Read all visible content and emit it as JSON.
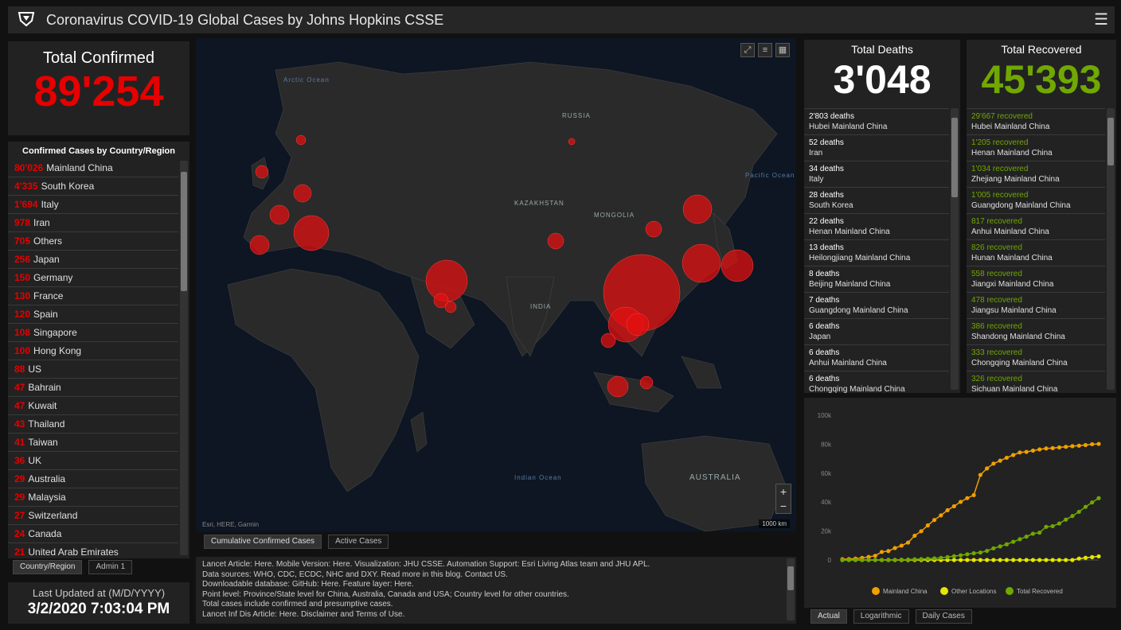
{
  "header": {
    "title": "Coronavirus COVID-19 Global Cases by Johns Hopkins CSSE",
    "logo_icon": "csse-shield-logo",
    "menu_icon": "hamburger-menu-icon"
  },
  "confirmed": {
    "label": "Total Confirmed",
    "value": "89'254",
    "color": "#e60000"
  },
  "country_list": {
    "heading": "Confirmed Cases by Country/Region",
    "rows": [
      {
        "count": "80'026",
        "name": "Mainland China"
      },
      {
        "count": "4'335",
        "name": "South Korea"
      },
      {
        "count": "1'694",
        "name": "Italy"
      },
      {
        "count": "978",
        "name": "Iran"
      },
      {
        "count": "705",
        "name": "Others"
      },
      {
        "count": "256",
        "name": "Japan"
      },
      {
        "count": "150",
        "name": "Germany"
      },
      {
        "count": "130",
        "name": "France"
      },
      {
        "count": "120",
        "name": "Spain"
      },
      {
        "count": "108",
        "name": "Singapore"
      },
      {
        "count": "100",
        "name": "Hong Kong"
      },
      {
        "count": "88",
        "name": "US"
      },
      {
        "count": "47",
        "name": "Bahrain"
      },
      {
        "count": "47",
        "name": "Kuwait"
      },
      {
        "count": "43",
        "name": "Thailand"
      },
      {
        "count": "41",
        "name": "Taiwan"
      },
      {
        "count": "36",
        "name": "UK"
      },
      {
        "count": "29",
        "name": "Australia"
      },
      {
        "count": "29",
        "name": "Malaysia"
      },
      {
        "count": "27",
        "name": "Switzerland"
      },
      {
        "count": "24",
        "name": "Canada"
      },
      {
        "count": "21",
        "name": "United Arab Emirates"
      }
    ],
    "tabs": [
      "Country/Region",
      "Admin 1"
    ]
  },
  "last_updated": {
    "label": "Last Updated at (M/D/YYYY)",
    "value": "3/2/2020 7:03:04 PM"
  },
  "map": {
    "labels": [
      "RUSSIA",
      "AUSTRALIA",
      "MONGOLIA",
      "KAZAKHSTAN",
      "INDIA",
      "Arctic Ocean",
      "Indian Ocean",
      "Pacific Ocean"
    ],
    "tools": [
      "expand-icon",
      "list-icon",
      "grid-icon"
    ],
    "zoom_in": "+",
    "zoom_out": "−",
    "attribution": "Esri, HERE, Garmin",
    "scale": "1000 km",
    "tabs": [
      "Cumulative Confirmed Cases",
      "Active Cases"
    ]
  },
  "info": {
    "lines": [
      "Lancet Article: Here. Mobile Version: Here. Visualization: JHU CSSE. Automation Support: Esri Living Atlas team and JHU APL.",
      "Data sources: WHO, CDC, ECDC, NHC and DXY. Read more in this blog. Contact US.",
      "Downloadable database: GitHub: Here. Feature layer: Here.",
      "Point level: Province/State level for China, Australia, Canada and USA; Country level for other countries.",
      "Total cases include confirmed and presumptive cases.",
      "Lancet Inf Dis Article: Here. Disclaimer and Terms of Use."
    ]
  },
  "deaths": {
    "label": "Total Deaths",
    "value": "3'048",
    "color": "#ffffff",
    "items": [
      {
        "t": "2'803 deaths",
        "s": "Hubei Mainland China"
      },
      {
        "t": "52 deaths",
        "s": "Iran"
      },
      {
        "t": "34 deaths",
        "s": "Italy"
      },
      {
        "t": "28 deaths",
        "s": "South Korea"
      },
      {
        "t": "22 deaths",
        "s": "Henan Mainland China"
      },
      {
        "t": "13 deaths",
        "s": "Heilongjiang Mainland China"
      },
      {
        "t": "8 deaths",
        "s": "Beijing Mainland China"
      },
      {
        "t": "7 deaths",
        "s": "Guangdong Mainland China"
      },
      {
        "t": "6 deaths",
        "s": "Japan"
      },
      {
        "t": "6 deaths",
        "s": "Anhui Mainland China"
      },
      {
        "t": "6 deaths",
        "s": "Chongqing Mainland China"
      }
    ]
  },
  "recovered": {
    "label": "Total Recovered",
    "value": "45'393",
    "color": "#70a800",
    "items": [
      {
        "t": "29'667 recovered",
        "s": "Hubei Mainland China"
      },
      {
        "t": "1'205 recovered",
        "s": "Henan Mainland China"
      },
      {
        "t": "1'034 recovered",
        "s": "Zhejiang Mainland China"
      },
      {
        "t": "1'005 recovered",
        "s": "Guangdong Mainland China"
      },
      {
        "t": "817 recovered",
        "s": "Anhui Mainland China"
      },
      {
        "t": "826 recovered",
        "s": "Hunan Mainland China"
      },
      {
        "t": "558 recovered",
        "s": "Jiangxi Mainland China"
      },
      {
        "t": "478 recovered",
        "s": "Jiangsu Mainland China"
      },
      {
        "t": "386 recovered",
        "s": "Shandong Mainland China"
      },
      {
        "t": "333 recovered",
        "s": "Chongqing Mainland China"
      },
      {
        "t": "326 recovered",
        "s": "Sichuan Mainland China"
      }
    ]
  },
  "chart_data": {
    "type": "line",
    "title": "",
    "xlabel": "",
    "ylabel": "",
    "ylim": [
      0,
      100000
    ],
    "yticks": [
      "100k",
      "80k",
      "60k",
      "40k",
      "20k",
      "0"
    ],
    "legend": "bottom",
    "grid": false,
    "series": [
      {
        "name": "Mainland China",
        "color": "#f0a000",
        "values": [
          555,
          653,
          941,
          1438,
          2118,
          2927,
          5578,
          6165,
          8235,
          9925,
          12038,
          16787,
          19881,
          23892,
          27636,
          30818,
          34392,
          37121,
          40151,
          42763,
          44803,
          58761,
          63265,
          66580,
          68595,
          70644,
          72528,
          74280,
          74675,
          75569,
          76392,
          77042,
          77262,
          77780,
          78190,
          78630,
          78959,
          79389,
          79968,
          80174
        ]
      },
      {
        "name": "Other Locations",
        "color": "#e6e600",
        "values": [
          0,
          0,
          0,
          0,
          0,
          0,
          0,
          0,
          0,
          0,
          0,
          0,
          0,
          0,
          0,
          0,
          0,
          0,
          0,
          0,
          0,
          0,
          0,
          0,
          0,
          0,
          0,
          0,
          0,
          0,
          0,
          0,
          0,
          0,
          0,
          0,
          1000,
          1500,
          2000,
          2500
        ]
      },
      {
        "name": "Total Recovered",
        "color": "#70a800",
        "values": [
          28,
          30,
          36,
          39,
          52,
          61,
          107,
          126,
          143,
          222,
          284,
          472,
          623,
          852,
          1124,
          1487,
          2011,
          2616,
          3244,
          3946,
          4683,
          5150,
          6295,
          8058,
          9395,
          10865,
          12583,
          14352,
          16121,
          18177,
          18890,
          22886,
          23394,
          25227,
          27905,
          30384,
          33277,
          36711,
          39782,
          42716
        ]
      }
    ]
  },
  "chart_tabs": [
    "Actual",
    "Logarithmic",
    "Daily Cases"
  ]
}
